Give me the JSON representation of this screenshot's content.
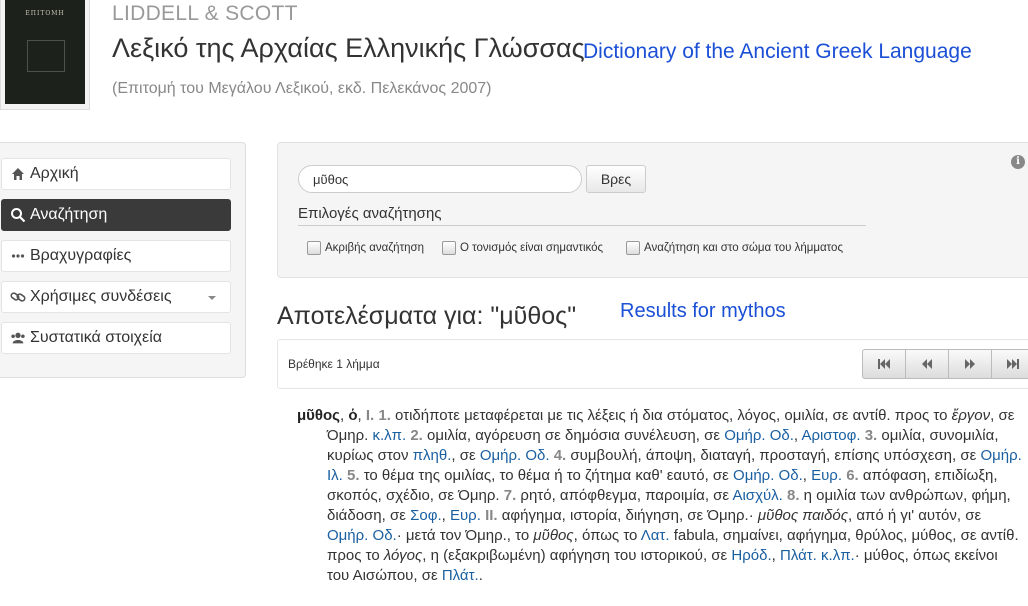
{
  "header": {
    "cover_title": "ΕΠΙΤΟΜΗ",
    "brand": "LIDDELL & SCOTT",
    "title_greek": "Λεξικό της Αρχαίας Ελληνικής Γλώσσας",
    "title_english": "Dictionary of the Ancient Greek Language",
    "subtitle": "(Επιτομή του Μεγάλου Λεξικού, εκδ. Πελεκάνος 2007)"
  },
  "sidebar": {
    "items": [
      {
        "label": "Αρχική",
        "icon": "home-icon",
        "active": false
      },
      {
        "label": "Αναζήτηση",
        "icon": "search-icon",
        "active": true
      },
      {
        "label": "Βραχυγραφίες",
        "icon": "ellipsis-icon",
        "active": false
      },
      {
        "label": "Χρήσιμες συνδέσεις",
        "icon": "link-icon",
        "active": false
      },
      {
        "label": "Συστατικά στοιχεία",
        "icon": "users-icon",
        "active": false
      }
    ]
  },
  "search": {
    "value": "μῦθος",
    "button": "Βρες",
    "options_title": "Επιλογές αναζήτησης",
    "options": [
      {
        "label": "Ακριβής αναζήτηση",
        "checked": false
      },
      {
        "label": "Ο τονισμός είναι σημαντικός",
        "checked": false
      },
      {
        "label": "Αναζήτηση και στο σώμα του λήμματος",
        "checked": false
      }
    ]
  },
  "results": {
    "title": "Αποτελέσματα για: \"μῦθος\"",
    "title_english": "Results for mythos",
    "found": "Βρέθηκε 1 λήμμα"
  },
  "entry": {
    "headword": "μῦθος",
    "article": "ὁ",
    "s1": "Ι. 1.",
    "t1": "οτιδήποτε μεταφέρεται με τις λέξεις ή δια στόματος, λόγος, ομιλία, σε αντίθ. προς το",
    "i1": "ἔργον",
    "t2": ", σε Όμηρ.",
    "l1": "κ.λπ.",
    "s2": "2.",
    "t3": "ομιλία, αγόρευση σε δημόσια συνέλευση, σε",
    "l2": "Ομήρ. Οδ.",
    "t4": ",",
    "l3": "Αριστοφ.",
    "s3": "3.",
    "t5": "ομιλία, συνομιλία, κυρίως στον",
    "l4": "πληθ.",
    "t6": ", σε",
    "l5": "Ομήρ. Οδ.",
    "s4": "4.",
    "t7": "συμβουλή, άποψη, διαταγή, προσταγή, επίσης υπόσχεση, σε",
    "l6": "Ομήρ. Ιλ.",
    "s5": "5.",
    "t8": "το θέμα της ομιλίας, το θέμα ή το ζήτημα καθ' εαυτό, σε",
    "l7": "Ομήρ. Οδ.",
    "t9": ",",
    "l8": "Ευρ.",
    "s6": "6.",
    "t10": "απόφαση, επιδίωξη, σκοπός, σχέδιο, σε Όμηρ.",
    "s7": "7.",
    "t11": "ρητό, απόφθεγμα, παροιμία, σε",
    "l9": "Αισχύλ.",
    "s8": "8.",
    "t12": "η ομιλία των ανθρώπων, φήμη, διάδοση, σε",
    "l10": "Σοφ.",
    "t13": ",",
    "l11": "Ευρ.",
    "s9": "ΙΙ.",
    "t14": "αφήγημα, ιστορία, διήγηση, σε Όμηρ.·",
    "i2": "μῦθος παιδός",
    "t15": ", από ή γι' αυτόν, σε",
    "l12": "Ομήρ. Οδ.",
    "t16": "· μετά τον Όμηρ., το",
    "i3": "μῦθος",
    "t17": ", όπως το",
    "l13": "Λατ.",
    "t18": "fabula, σημαίνει, αφήγημα, θρύλος, μύθος, σε αντίθ. προς το",
    "i4": "λόγος",
    "t19": ", η (εξακριβωμένη) αφήγηση του ιστορικού, σε",
    "l14": "Ηρόδ.",
    "t20": ",",
    "l15": "Πλάτ. κ.λπ.",
    "t21": "· μύθος, όπως εκείνοι του Αισώπου, σε",
    "l16": "Πλάτ.",
    "t22": "."
  }
}
